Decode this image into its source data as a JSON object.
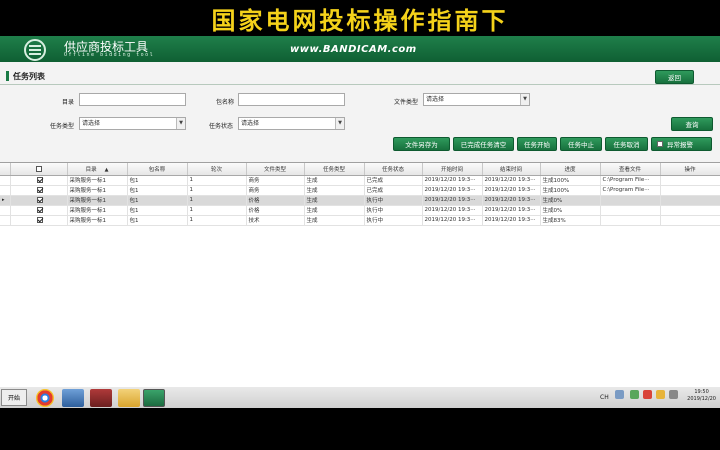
{
  "caption": "国家电网投标操作指南下",
  "header": {
    "title": "供应商投标工具",
    "subtitle": "Offline  bidding  tool",
    "watermark": "www.BANDICAM.com"
  },
  "page": {
    "title": "任务列表",
    "back_label": "返回"
  },
  "filters": {
    "catalog_label": "目录",
    "package_label": "包名称",
    "file_type_label": "文件类型",
    "file_type_value": "请选择",
    "task_type_label": "任务类型",
    "task_type_value": "请选择",
    "task_status_label": "任务状态",
    "task_status_value": "请选择",
    "query_label": "查询"
  },
  "actions": {
    "save_as": "文件另存为",
    "clear_done": "已完成任务清空",
    "start": "任务开始",
    "pause": "任务中止",
    "cancel": "任务取消",
    "alarm": "异常报警"
  },
  "table": {
    "columns": [
      "",
      "目录",
      "包名称",
      "轮次",
      "文件类型",
      "任务类型",
      "任务状态",
      "开始时间",
      "结束时间",
      "进度",
      "查看文件",
      "操作"
    ],
    "rows": [
      {
        "catalog": "采购服务一标1",
        "package": "包1",
        "round": "1",
        "file_type": "商务",
        "task_type": "生成",
        "status": "已完成",
        "start": "2019/12/20 19:3···",
        "end": "2019/12/20 19:3···",
        "progress": "生成100%",
        "file": "C:\\Program File···"
      },
      {
        "catalog": "采购服务一标1",
        "package": "包1",
        "round": "1",
        "file_type": "商务",
        "task_type": "生成",
        "status": "已完成",
        "start": "2019/12/20 19:3···",
        "end": "2019/12/20 19:3···",
        "progress": "生成100%",
        "file": "C:\\Program File···"
      },
      {
        "catalog": "采购服务一标1",
        "package": "包1",
        "round": "1",
        "file_type": "价格",
        "task_type": "生成",
        "status": "执行中",
        "start": "2019/12/20 19:3···",
        "end": "2019/12/20 19:3···",
        "progress": "生成0%",
        "file": ""
      },
      {
        "catalog": "采购服务一标1",
        "package": "包1",
        "round": "1",
        "file_type": "价格",
        "task_type": "生成",
        "status": "执行中",
        "start": "2019/12/20 19:3···",
        "end": "2019/12/20 19:3···",
        "progress": "生成0%",
        "file": ""
      },
      {
        "catalog": "采购服务一标1",
        "package": "包1",
        "round": "1",
        "file_type": "技术",
        "task_type": "生成",
        "status": "执行中",
        "start": "2019/12/20 19:3···",
        "end": "2019/12/20 19:3···",
        "progress": "生成83%",
        "file": ""
      }
    ]
  },
  "taskbar": {
    "start_label": "开始",
    "ime": "CH",
    "time": "19:50",
    "date": "2019/12/20"
  },
  "colors": {
    "brand_green": "#17703d",
    "caption_yellow": "#f5d21a"
  }
}
